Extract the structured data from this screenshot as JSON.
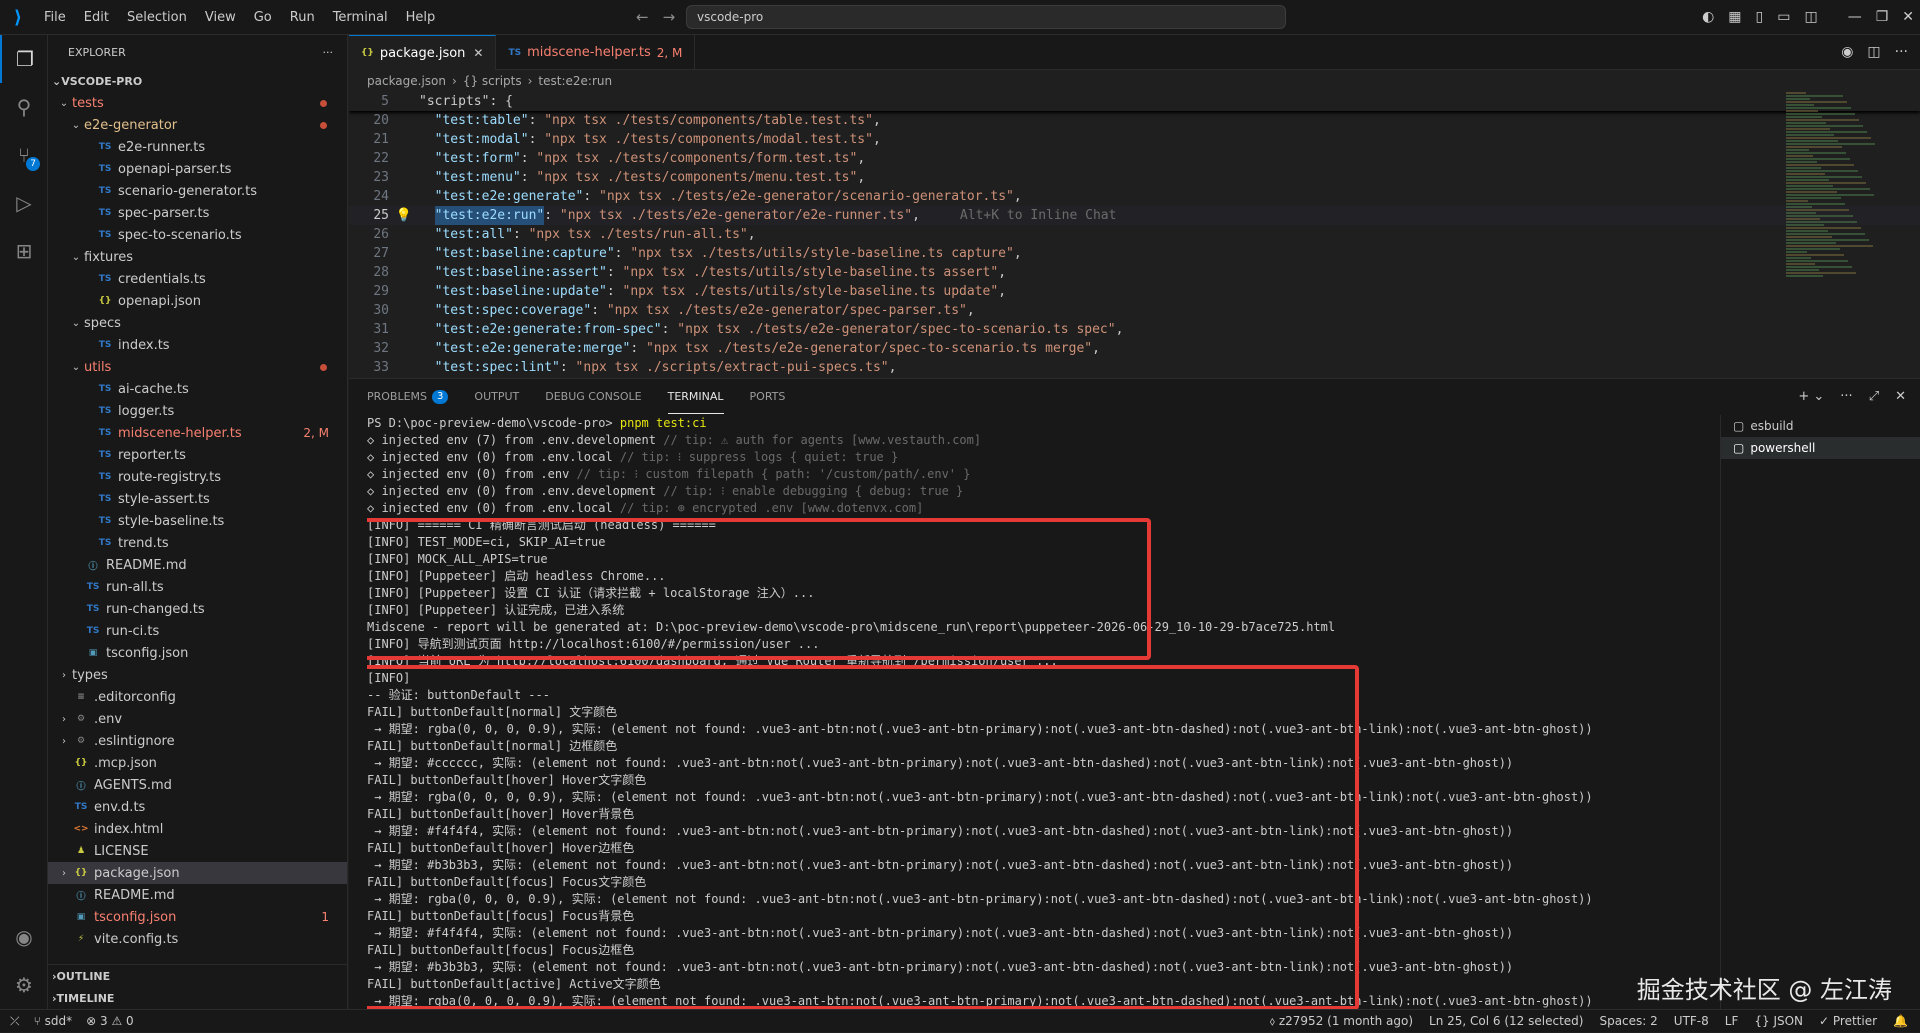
{
  "titlebar": {
    "menu": [
      "File",
      "Edit",
      "Selection",
      "View",
      "Go",
      "Run",
      "Terminal",
      "Help"
    ],
    "search": "vscode-pro"
  },
  "explorer": {
    "header": "EXPLORER",
    "more": "···",
    "project": "VSCODE-PRO",
    "tree": [
      {
        "label": "tests",
        "kind": "folder",
        "depth": 0,
        "open": true,
        "color": "#f88070",
        "dot": true
      },
      {
        "label": "e2e-generator",
        "kind": "folder",
        "depth": 1,
        "open": true,
        "color": "#e2c08d",
        "dot": true
      },
      {
        "label": "e2e-runner.ts",
        "kind": "ts",
        "depth": 2
      },
      {
        "label": "openapi-parser.ts",
        "kind": "ts",
        "depth": 2
      },
      {
        "label": "scenario-generator.ts",
        "kind": "ts",
        "depth": 2
      },
      {
        "label": "spec-parser.ts",
        "kind": "ts",
        "depth": 2
      },
      {
        "label": "spec-to-scenario.ts",
        "kind": "ts",
        "depth": 2
      },
      {
        "label": "fixtures",
        "kind": "folder",
        "depth": 1,
        "open": true
      },
      {
        "label": "credentials.ts",
        "kind": "ts",
        "depth": 2
      },
      {
        "label": "openapi.json",
        "kind": "json",
        "depth": 2
      },
      {
        "label": "specs",
        "kind": "folder",
        "depth": 1,
        "open": true
      },
      {
        "label": "index.ts",
        "kind": "ts",
        "depth": 2
      },
      {
        "label": "utils",
        "kind": "folder",
        "depth": 1,
        "open": true,
        "color": "#f88070",
        "dot": true
      },
      {
        "label": "ai-cache.ts",
        "kind": "ts",
        "depth": 2
      },
      {
        "label": "logger.ts",
        "kind": "ts",
        "depth": 2
      },
      {
        "label": "midscene-helper.ts",
        "kind": "ts",
        "depth": 2,
        "color": "#f88070",
        "deco": "2, M"
      },
      {
        "label": "reporter.ts",
        "kind": "ts",
        "depth": 2
      },
      {
        "label": "route-registry.ts",
        "kind": "ts",
        "depth": 2
      },
      {
        "label": "style-assert.ts",
        "kind": "ts",
        "depth": 2
      },
      {
        "label": "style-baseline.ts",
        "kind": "ts",
        "depth": 2
      },
      {
        "label": "trend.ts",
        "kind": "ts",
        "depth": 2
      },
      {
        "label": "README.md",
        "kind": "md",
        "depth": 1
      },
      {
        "label": "run-all.ts",
        "kind": "ts",
        "depth": 1
      },
      {
        "label": "run-changed.ts",
        "kind": "ts",
        "depth": 1
      },
      {
        "label": "run-ci.ts",
        "kind": "ts",
        "depth": 1
      },
      {
        "label": "tsconfig.json",
        "kind": "jsonb",
        "depth": 1
      },
      {
        "label": "types",
        "kind": "folder",
        "depth": 0,
        "open": false
      },
      {
        "label": ".editorconfig",
        "kind": "cfg",
        "depth": 0
      },
      {
        "label": ".env",
        "kind": "gear",
        "depth": 0,
        "open": false,
        "folderlike": true
      },
      {
        "label": ".eslintignore",
        "kind": "gear",
        "depth": 0,
        "open": false,
        "folderlike": true
      },
      {
        "label": ".mcp.json",
        "kind": "json",
        "depth": 0
      },
      {
        "label": "AGENTS.md",
        "kind": "md",
        "depth": 0
      },
      {
        "label": "env.d.ts",
        "kind": "ts",
        "depth": 0
      },
      {
        "label": "index.html",
        "kind": "html",
        "depth": 0
      },
      {
        "label": "LICENSE",
        "kind": "lic",
        "depth": 0
      },
      {
        "label": "package.json",
        "kind": "json",
        "depth": 0,
        "open": false,
        "folderlike": true,
        "selected": true
      },
      {
        "label": "README.md",
        "kind": "md",
        "depth": 0
      },
      {
        "label": "tsconfig.json",
        "kind": "jsonb",
        "depth": 0,
        "color": "#f88070",
        "deco": "1"
      },
      {
        "label": "vite.config.ts",
        "kind": "vite",
        "depth": 0
      }
    ],
    "outline": "OUTLINE",
    "timeline": "TIMELINE"
  },
  "activity": {
    "scm_badge": "7"
  },
  "editor": {
    "tabs": [
      {
        "label": "package.json",
        "icon": "{}",
        "active": true
      },
      {
        "label": "midscene-helper.ts",
        "icon": "TS",
        "suffix": "2, M"
      }
    ],
    "breadcrumb": [
      "package.json",
      "{} scripts",
      "test:e2e:run"
    ],
    "sticky": {
      "num": "5",
      "text": "\"scripts\": {"
    },
    "lines": [
      {
        "num": "20",
        "key": "\"test:table\"",
        "val": "\"npx tsx ./tests/components/table.test.ts\""
      },
      {
        "num": "21",
        "key": "\"test:modal\"",
        "val": "\"npx tsx ./tests/components/modal.test.ts\""
      },
      {
        "num": "22",
        "key": "\"test:form\"",
        "val": "\"npx tsx ./tests/components/form.test.ts\""
      },
      {
        "num": "23",
        "key": "\"test:menu\"",
        "val": "\"npx tsx ./tests/components/menu.test.ts\""
      },
      {
        "num": "24",
        "key": "\"test:e2e:generate\"",
        "val": "\"npx tsx ./tests/e2e-generator/scenario-generator.ts\""
      },
      {
        "num": "25",
        "key": "\"test:e2e:run\"",
        "val": "\"npx tsx ./tests/e2e-generator/e2e-runner.ts\"",
        "hint": "Alt+K to Inline Chat",
        "current": true
      },
      {
        "num": "26",
        "key": "\"test:all\"",
        "val": "\"npx tsx ./tests/run-all.ts\""
      },
      {
        "num": "27",
        "key": "\"test:baseline:capture\"",
        "val": "\"npx tsx ./tests/utils/style-baseline.ts capture\""
      },
      {
        "num": "28",
        "key": "\"test:baseline:assert\"",
        "val": "\"npx tsx ./tests/utils/style-baseline.ts assert\""
      },
      {
        "num": "29",
        "key": "\"test:baseline:update\"",
        "val": "\"npx tsx ./tests/utils/style-baseline.ts update\""
      },
      {
        "num": "30",
        "key": "\"test:spec:coverage\"",
        "val": "\"npx tsx ./tests/e2e-generator/spec-parser.ts\""
      },
      {
        "num": "31",
        "key": "\"test:e2e:generate:from-spec\"",
        "val": "\"npx tsx ./tests/e2e-generator/spec-to-scenario.ts spec\""
      },
      {
        "num": "32",
        "key": "\"test:e2e:generate:merge\"",
        "val": "\"npx tsx ./tests/e2e-generator/spec-to-scenario.ts merge\""
      },
      {
        "num": "33",
        "key": "\"test:spec:lint\"",
        "val": "\"npx tsx ./scripts/extract-pui-specs.ts\""
      }
    ]
  },
  "panel": {
    "tabs": [
      {
        "label": "PROBLEMS",
        "badge": "3"
      },
      {
        "label": "OUTPUT"
      },
      {
        "label": "DEBUG CONSOLE"
      },
      {
        "label": "TERMINAL",
        "active": true
      },
      {
        "label": "PORTS"
      }
    ],
    "terminals": [
      "esbuild",
      "powershell"
    ],
    "prompt": "PS D:\\poc-preview-demo\\vscode-pro>",
    "command": "pnpm test:ci",
    "env_lines": [
      {
        "text": "◇ injected env (7) from .env.development",
        "tip": "// tip: ⚠ auth for agents [www.vestauth.com]"
      },
      {
        "text": "◇ injected env (0) from .env.local",
        "tip": "// tip: ⁝ suppress logs { quiet: true }"
      },
      {
        "text": "◇ injected env (0) from .env",
        "tip": "// tip: ⁝ custom filepath { path: '/custom/path/.env' }"
      },
      {
        "text": "◇ injected env (0) from .env.development",
        "tip": "// tip: ⁝ enable debugging { debug: true }"
      },
      {
        "text": "◇ injected env (0) from .env.local",
        "tip": "// tip: ⊕ encrypted .env [www.dotenvx.com]"
      }
    ],
    "info_lines": [
      "[INFO] ====== CI 精确断言测试启动 (headless) ======",
      "[INFO] TEST_MODE=ci, SKIP_AI=true",
      "[INFO] MOCK_ALL_APIS=true",
      "[INFO] [Puppeteer] 启动 headless Chrome...",
      "[INFO] [Puppeteer] 设置 CI 认证（请求拦截 + localStorage 注入）...",
      "[INFO] [Puppeteer] 认证完成，已进入系统",
      "Midscene - report will be generated at: D:\\poc-preview-demo\\vscode-pro\\midscene_run\\report\\puppeteer-2026-06-29_10-10-29-b7ace725.html",
      "[INFO] 导航到测试页面 http://localhost:6100/#/permission/user ...",
      "[INFO] 当前 URL 为 http://localhost:6100/dashboard, 通过 Vue Router 重新导航到 /permission/user ...",
      "[INFO]"
    ],
    "fail_lines": [
      "-- 验证: buttonDefault ---",
      "FAIL] buttonDefault[normal] 文字颜色",
      " → 期望: rgba(0, 0, 0, 0.9), 实际: (element not found: .vue3-ant-btn:not(.vue3-ant-btn-primary):not(.vue3-ant-btn-dashed):not(.vue3-ant-btn-link):not(.vue3-ant-btn-ghost))",
      "FAIL] buttonDefault[normal] 边框颜色",
      " → 期望: #cccccc, 实际: (element not found: .vue3-ant-btn:not(.vue3-ant-btn-primary):not(.vue3-ant-btn-dashed):not(.vue3-ant-btn-link):not(.vue3-ant-btn-ghost))",
      "FAIL] buttonDefault[hover] Hover文字颜色",
      " → 期望: rgba(0, 0, 0, 0.9), 实际: (element not found: .vue3-ant-btn:not(.vue3-ant-btn-primary):not(.vue3-ant-btn-dashed):not(.vue3-ant-btn-link):not(.vue3-ant-btn-ghost))",
      "FAIL] buttonDefault[hover] Hover背景色",
      " → 期望: #f4f4f4, 实际: (element not found: .vue3-ant-btn:not(.vue3-ant-btn-primary):not(.vue3-ant-btn-dashed):not(.vue3-ant-btn-link):not(.vue3-ant-btn-ghost))",
      "FAIL] buttonDefault[hover] Hover边框色",
      " → 期望: #b3b3b3, 实际: (element not found: .vue3-ant-btn:not(.vue3-ant-btn-primary):not(.vue3-ant-btn-dashed):not(.vue3-ant-btn-link):not(.vue3-ant-btn-ghost))",
      "FAIL] buttonDefault[focus] Focus文字颜色",
      " → 期望: rgba(0, 0, 0, 0.9), 实际: (element not found: .vue3-ant-btn:not(.vue3-ant-btn-primary):not(.vue3-ant-btn-dashed):not(.vue3-ant-btn-link):not(.vue3-ant-btn-ghost))",
      "FAIL] buttonDefault[focus] Focus背景色",
      " → 期望: #f4f4f4, 实际: (element not found: .vue3-ant-btn:not(.vue3-ant-btn-primary):not(.vue3-ant-btn-dashed):not(.vue3-ant-btn-link):not(.vue3-ant-btn-ghost))",
      "FAIL] buttonDefault[focus] Focus边框色",
      " → 期望: #b3b3b3, 实际: (element not found: .vue3-ant-btn:not(.vue3-ant-btn-primary):not(.vue3-ant-btn-dashed):not(.vue3-ant-btn-link):not(.vue3-ant-btn-ghost))",
      "FAIL] buttonDefault[active] Active文字颜色",
      " → 期望: rgba(0, 0, 0, 0.9), 实际: (element not found: .vue3-ant-btn:not(.vue3-ant-btn-primary):not(.vue3-ant-btn-dashed):not(.vue3-ant-btn-link):not(.vue3-ant-btn-ghost))"
    ]
  },
  "statusbar": {
    "branch": "sdd*",
    "problems": "⊗ 3 ⚠ 0",
    "right": [
      "⬨ z27952 (1 month ago)",
      "Ln 25, Col 6 (12 selected)",
      "Spaces: 2",
      "UTF-8",
      "LF",
      "{} JSON",
      "✓ Prettier"
    ]
  },
  "watermark": "掘金技术社区 @ 左江涛",
  "colors": {
    "highlight_box": "#e53935",
    "accent": "#0078d4"
  }
}
